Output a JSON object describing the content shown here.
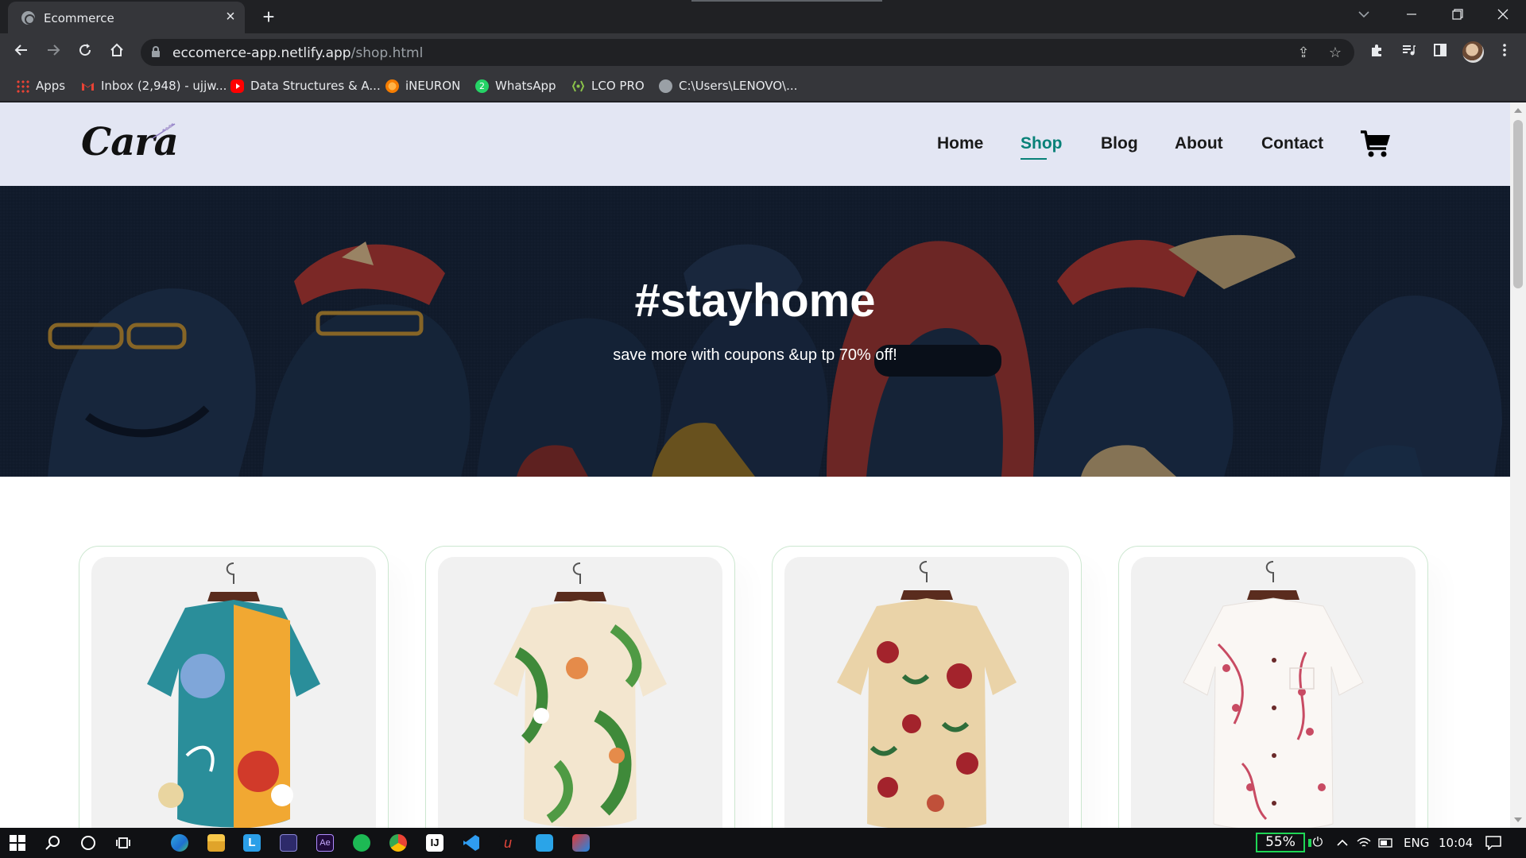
{
  "browser": {
    "tab_title": "Ecommerce",
    "url_host": "eccomerce-app.netlify.app",
    "url_path": "/shop.html",
    "bookmarks": [
      {
        "label": "Apps",
        "icon": "apps-grid-icon"
      },
      {
        "label": "Inbox (2,948) - ujjw...",
        "icon": "gmail-icon"
      },
      {
        "label": "Data Structures & A...",
        "icon": "youtube-icon"
      },
      {
        "label": "iNEURON",
        "icon": "ineuron-icon"
      },
      {
        "label": "WhatsApp",
        "icon": "whatsapp-icon"
      },
      {
        "label": "LCO PRO",
        "icon": "lco-icon"
      },
      {
        "label": "C:\\Users\\LENOVO\\...",
        "icon": "globe-icon"
      }
    ]
  },
  "site": {
    "logo": "Cara",
    "nav": [
      {
        "label": "Home",
        "active": false
      },
      {
        "label": "Shop",
        "active": true
      },
      {
        "label": "Blog",
        "active": false
      },
      {
        "label": "About",
        "active": false
      },
      {
        "label": "Contact",
        "active": false
      }
    ],
    "accent_color": "#088178",
    "hero": {
      "title": "#stayhome",
      "subtitle": "save more with coupons &up tp 70% off!"
    },
    "products": [
      {
        "name": "tropical-print-shirt",
        "colors": [
          "#2a8e9a",
          "#f1a832",
          "#d13a2a",
          "#7fa6d9"
        ]
      },
      {
        "name": "leaf-print-shirt",
        "colors": [
          "#f3e6cf",
          "#3f8a3a",
          "#e58b4a"
        ]
      },
      {
        "name": "floral-print-shirt",
        "colors": [
          "#ead3a8",
          "#a3232c",
          "#2f6d3a"
        ]
      },
      {
        "name": "blossom-print-shirt",
        "colors": [
          "#faf7f4",
          "#c84b63",
          "#6a2a2a"
        ]
      }
    ]
  },
  "taskbar": {
    "battery": "55%",
    "language": "ENG",
    "time": "10:04"
  }
}
